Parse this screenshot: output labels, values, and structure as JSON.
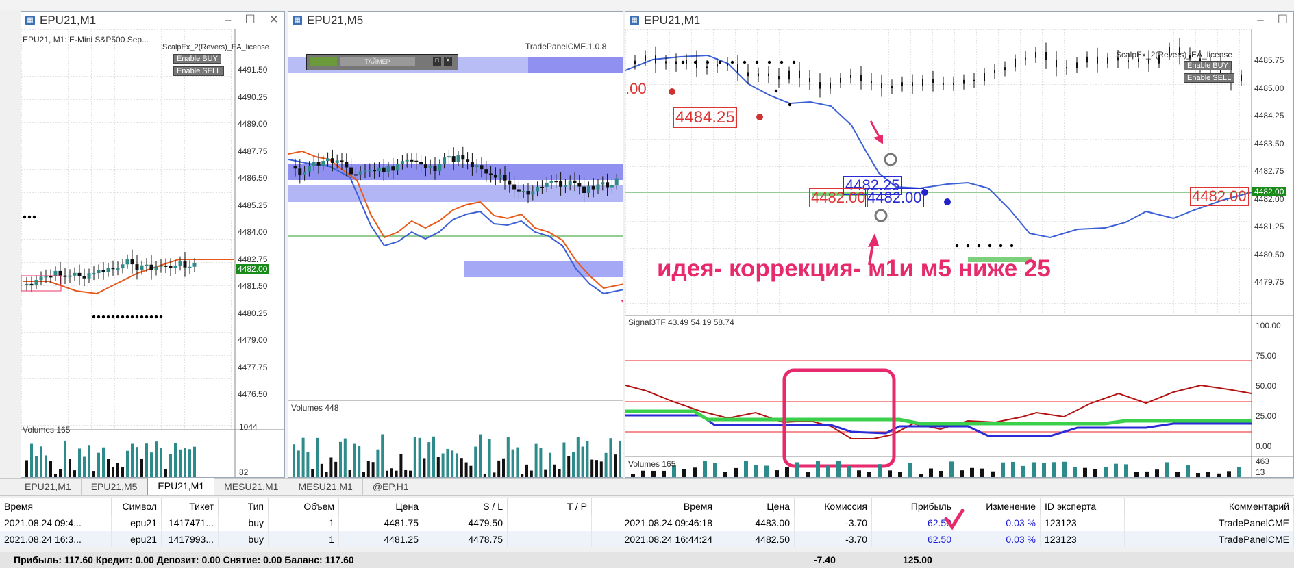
{
  "windows": [
    {
      "title": "EPU21,M1",
      "header": "EPU21, M1:  E-Mini S&P500 Sep...",
      "header_ea": "ScalpEx_2(Revers)_EA_license",
      "btn_buy": "Enable BUY",
      "btn_sell": "Enable SELL",
      "prices": [
        "4491.50",
        "4490.25",
        "4489.00",
        "4487.75",
        "4486.50",
        "4485.25",
        "4484.00",
        "4482.75",
        "4481.50",
        "4480.25",
        "4479.00",
        "4477.75",
        "4476.50"
      ],
      "current_price": "4482.00",
      "volumes_label": "Volumes 165",
      "vol_scale_top": "1044",
      "vol_scale_bottom": "82"
    },
    {
      "title": "EPU21,M5",
      "header_ea": "TradePanelCME.1.0.8",
      "timer_label": "ТАЙМЕР",
      "timer_box": "□",
      "timer_close": "X",
      "volumes_label": "Volumes 448"
    },
    {
      "title": "EPU21,M1",
      "header_ea": "ScalpEx_2(Revers)_EA_license",
      "btn_buy": "Enable BUY",
      "btn_sell": "Enable SELL",
      "prices": [
        "4485.75",
        "4485.00",
        "4484.25",
        "4483.50",
        "4482.75",
        "4482.00",
        "4481.25",
        "4480.50",
        "4479.75"
      ],
      "current_price": "4482.00",
      "labels": {
        "l1": ".00",
        "l2": "4484.25",
        "l3": "4482.25",
        "l4": "4482.00",
        "l5": "4482.00",
        "l6": "4482.00"
      },
      "annotation": "идея- коррекция- м1и м5 ниже 25",
      "indicator_label": "Signal3TF 43.49 54.19 58.74",
      "ind_scale": [
        "100.00",
        "75.00",
        "50.00",
        "25.00",
        "0.00"
      ],
      "volumes_label": "Volumes 165",
      "vol_scale_top": "463",
      "vol_scale_bottom": "13"
    }
  ],
  "tabs": [
    "EPU21,M1",
    "EPU21,M5",
    "EPU21,M1",
    "MESU21,M1",
    "MESU21,M1",
    "@EP,H1"
  ],
  "active_tab_index": 2,
  "orders": {
    "headers": [
      "Время",
      "Символ",
      "Тикет",
      "Тип",
      "Объем",
      "Цена",
      "S / L",
      "T / P",
      "Время",
      "Цена",
      "Комиссия",
      "Прибыль",
      "Изменение",
      "ID эксперта",
      "Комментарий"
    ],
    "rows": [
      [
        "2021.08.24 09:4...",
        "epu21",
        "1417471...",
        "buy",
        "1",
        "4481.75",
        "4479.50",
        "",
        "2021.08.24 09:46:18",
        "4483.00",
        "-3.70",
        "62.50",
        "0.03 %",
        "123123",
        "TradePanelCME"
      ],
      [
        "2021.08.24 16:3...",
        "epu21",
        "1417993...",
        "buy",
        "1",
        "4481.25",
        "4478.75",
        "",
        "2021.08.24 16:44:24",
        "4482.50",
        "-3.70",
        "62.50",
        "0.03 %",
        "123123",
        "TradePanelCME"
      ]
    ]
  },
  "footer": {
    "summary": "Прибыль: 117.60  Кредит: 0.00  Депозит: 0.00  Снятие: 0.00  Баланс: 117.60",
    "commission": "-7.40",
    "profit": "125.00"
  },
  "colors": {
    "bull": "#2e8b8b",
    "bear": "#111111",
    "ma_blue": "#3a5fd6",
    "ma_red": "#e8591a",
    "zone": "#8f90f0",
    "accent": "#e62a6c"
  }
}
